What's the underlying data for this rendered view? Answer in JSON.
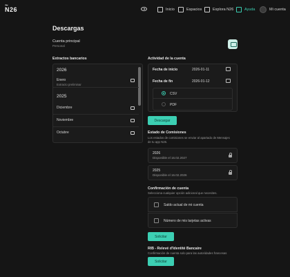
{
  "brand": {
    "logo": "N26"
  },
  "nav": [
    {
      "label": "Inicio",
      "icon": "home-icon"
    },
    {
      "label": "Espacios",
      "icon": "spaces-icon"
    },
    {
      "label": "Explora N26",
      "icon": "explore-icon"
    },
    {
      "label": "Ayuda",
      "icon": "help-icon",
      "active": true
    },
    {
      "label": "Mi cuenta",
      "icon": "avatar"
    }
  ],
  "page": {
    "title": "Descargas"
  },
  "account": {
    "label": "Cuenta principal",
    "sub": "Personal"
  },
  "statements": {
    "heading": "Extractos bancarios",
    "years": [
      {
        "year": "2026",
        "rows": [
          {
            "label": "Enero",
            "sub": "Extracto preliminar"
          }
        ]
      },
      {
        "year": "2025",
        "rows": [
          {
            "label": "Diciembre"
          },
          {
            "label": "Noviembre"
          },
          {
            "label": "Octubre"
          }
        ]
      }
    ]
  },
  "activity": {
    "heading": "Actividad de la cuenta",
    "start_label": "Fecha de inicio",
    "start_value": "2026-01-11",
    "end_label": "Fecha de fin",
    "end_value": "2026-01-12",
    "formats": [
      {
        "label": "CSV",
        "selected": true
      },
      {
        "label": "PDF",
        "selected": false
      }
    ],
    "button": "Descargar"
  },
  "commissions": {
    "heading": "Estado de Comisiones",
    "desc_1": "Los estados de comisiones se enviar al apartado de Mensajes",
    "desc_2": "de tu app N26.",
    "rows": [
      {
        "year": "2026",
        "date": "Disponible el 16.02.2027"
      },
      {
        "year": "2025",
        "date": "Disponible el 16.02.2026"
      }
    ]
  },
  "confirmation": {
    "heading": "Confirmación de cuenta",
    "desc": "Selecciona cualquier opción adicional que necesites.",
    "options": [
      "Saldo actual de mi cuenta",
      "Número de mis tarjetas activas"
    ],
    "button": "Solicitar"
  },
  "rib": {
    "heading": "RIB - Relevé d'Identité Bancaire",
    "desc": "Confirmación de cuenta solo para las autoridades francesas",
    "button": "Solicitar"
  },
  "colors": {
    "accent": "#3ccfb3",
    "background": "#151515",
    "panel": "#1b1b1b"
  }
}
